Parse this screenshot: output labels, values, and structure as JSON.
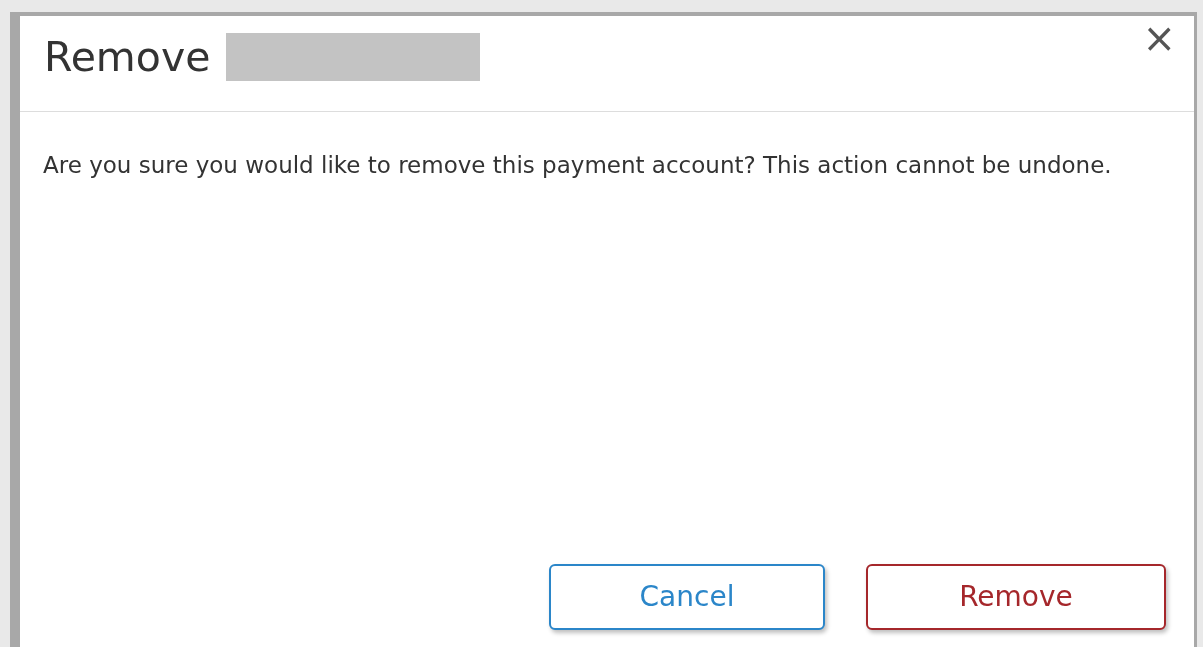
{
  "dialog": {
    "title": "Remove",
    "title_redacted": true,
    "close": "×",
    "message": "Are you sure you would like to remove this payment account? This action cannot be undone.",
    "buttons": [
      {
        "label": "Cancel",
        "kind": "secondary"
      },
      {
        "label": "Remove",
        "kind": "danger"
      }
    ]
  }
}
